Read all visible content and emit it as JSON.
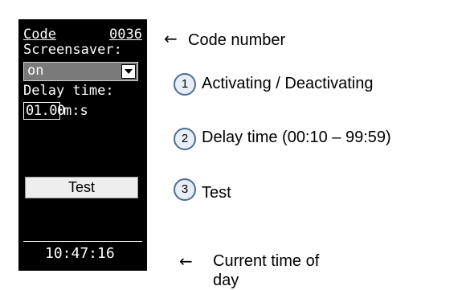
{
  "panel": {
    "code_label": "Code",
    "code_value": "0036",
    "screensaver_label": "Screensaver:",
    "screensaver_value": "on",
    "delay_label": "Delay time:",
    "delay_value": "01.00",
    "delay_unit": "m:s",
    "test_button": "Test",
    "clock": "10:47:16"
  },
  "annotations": {
    "code": "Code number",
    "n1": "1",
    "activating": "Activating / Deactivating",
    "n2": "2",
    "delay": "Delay time (00:10 – 99:59)",
    "n3": "3",
    "test": "Test",
    "current_time": "Current      time      of",
    "current_time_2": "day"
  }
}
